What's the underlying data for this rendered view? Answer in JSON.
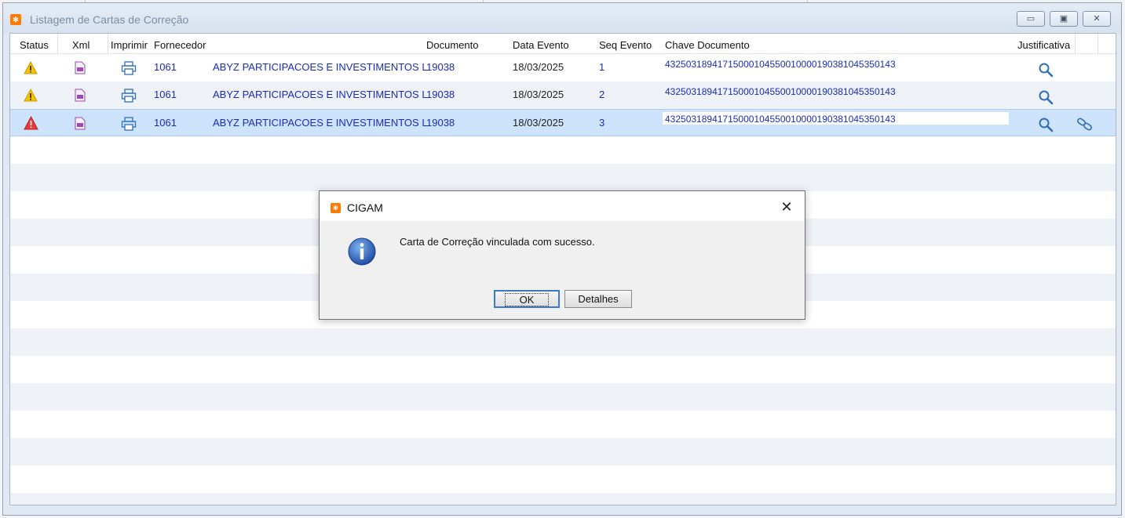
{
  "window": {
    "title": "Listagem de Cartas de Correção",
    "app_icon": "cigam-logo-icon",
    "controls": [
      "minimize-icon",
      "restore-icon",
      "close-icon"
    ]
  },
  "grid": {
    "headers": {
      "status": "Status",
      "xml": "Xml",
      "imprimir": "Imprimir",
      "fornecedor": "Fornecedor",
      "documento": "Documento",
      "data_evento": "Data Evento",
      "seq_evento": "Seq Evento",
      "chave": "Chave Documento",
      "justificativa": "Justificativa"
    },
    "rows": [
      {
        "status_icon": "warning-yellow-icon",
        "xml_icon": "xml-file-icon",
        "print_icon": "printer-icon",
        "codigo": "1061",
        "fornecedor": "ABYZ PARTICIPACOES E INVESTIMENTOS L",
        "documento": "19038",
        "data_evento": "18/03/2025",
        "seq_evento": "1",
        "chave": "43250318941715000104550010000190381045350143",
        "justificativa_icon": "search-icon"
      },
      {
        "status_icon": "warning-yellow-icon",
        "xml_icon": "xml-file-icon",
        "print_icon": "printer-icon",
        "codigo": "1061",
        "fornecedor": "ABYZ PARTICIPACOES E INVESTIMENTOS L",
        "documento": "19038",
        "data_evento": "18/03/2025",
        "seq_evento": "2",
        "chave": "43250318941715000104550010000190381045350143",
        "justificativa_icon": "search-icon"
      },
      {
        "status_icon": "warning-red-icon",
        "xml_icon": "xml-file-icon",
        "print_icon": "printer-icon",
        "codigo": "1061",
        "fornecedor": "ABYZ PARTICIPACOES E INVESTIMENTOS L",
        "documento": "19038",
        "data_evento": "18/03/2025",
        "seq_evento": "3",
        "chave": "43250318941715000104550010000190381045350143",
        "justificativa_icon": "search-icon",
        "link_icon": "link-icon",
        "selected": true
      }
    ]
  },
  "dialog": {
    "title": "CIGAM",
    "message": "Carta de Correção vinculada com sucesso.",
    "icon": "info-icon",
    "ok_label": "OK",
    "details_label": "Detalhes"
  },
  "colors": {
    "link_text": "#1a2db8",
    "selected_row": "#cde3fb",
    "alt_row": "#eef1f6",
    "warning_yellow": "#f5c400",
    "warning_red": "#e23b3b",
    "accent_blue": "#2f6fb8"
  }
}
